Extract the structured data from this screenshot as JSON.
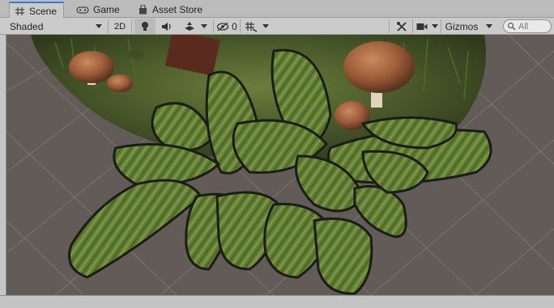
{
  "tabs": [
    {
      "label": "Scene",
      "icon": "grid-icon",
      "active": true
    },
    {
      "label": "Game",
      "icon": "gamepad-icon",
      "active": false
    },
    {
      "label": "Asset Store",
      "icon": "shopping-bag-icon",
      "active": false
    }
  ],
  "toolbar": {
    "shading_mode": "Shaded",
    "mode_2d": "2D",
    "hidden_count": "0",
    "gizmos_label": "Gizmos",
    "search_placeholder": "All",
    "icons": [
      "lightbulb-icon",
      "audio-icon",
      "effects-icon",
      "hidden-objects-icon",
      "grid-snap-icon",
      "tools-icon",
      "camera-icon",
      "search-icon"
    ]
  },
  "colors": {
    "accent": "#3a7bd5",
    "viewport_bg": "#625b57",
    "grid_line": "#7a736f"
  }
}
